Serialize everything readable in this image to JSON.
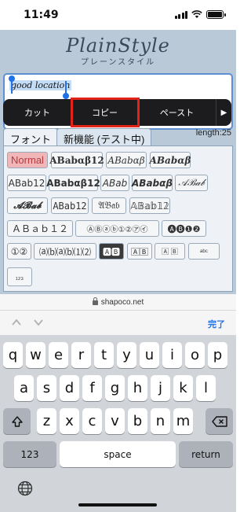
{
  "status_bar": {
    "time": "11:49"
  },
  "page": {
    "logo_main": "PlainStyle",
    "logo_sub": "プレーンスタイル",
    "input_value": "good location",
    "context_menu": {
      "cut": "カット",
      "copy": "コピー",
      "paste": "ペースト",
      "more_icon": "triangle-right-icon"
    },
    "tabs": [
      "フォント",
      "新機能 (テスト中)"
    ],
    "length_label": "length:25",
    "font_buttons": [
      [
        "Normal",
        "𝐀𝐁𝐚𝐛𝛂𝛃𝟏𝟐",
        "𝐴𝐵𝑎𝑏𝛼𝛽",
        "𝑨𝑩𝒂𝒃𝜶𝜷"
      ],
      [
        "𝖠𝖡𝖺𝖻𝟣𝟤",
        "𝗔𝗕𝗮𝗯𝝰𝝱𝟭𝟮",
        "𝘈𝘉𝘢𝘣",
        "𝘼𝘽𝙖𝙗𝞪𝞫",
        "𝒜ℬ𝒶𝒷"
      ],
      [
        "𝓐𝓑𝓪𝓫",
        "𝙰𝙱𝚊𝚋𝟷𝟸",
        "𝔄𝔅𝔞𝔟",
        "𝔸𝔹𝕒𝕓𝟙𝟚"
      ],
      [
        "ＡＢａｂ１２",
        "ⒶⒷⓐⓑ①②㋐㋑",
        "🅐🅑❶❷"
      ],
      [
        "①②",
        "⒜⒝⒜⒝⑴⑵",
        "🅰🅱",
        "🄰🄱",
        "🄰 🄱",
        "ᵃᵇᶜ"
      ],
      [
        "₁₂₃"
      ]
    ]
  },
  "url_bar": {
    "domain": "shapoco.net"
  },
  "accessory": {
    "done": "完了"
  },
  "keyboard": {
    "row1": [
      "q",
      "w",
      "e",
      "r",
      "t",
      "y",
      "u",
      "i",
      "o",
      "p"
    ],
    "row2": [
      "a",
      "s",
      "d",
      "f",
      "g",
      "h",
      "j",
      "k",
      "l"
    ],
    "row3": [
      "z",
      "x",
      "c",
      "v",
      "b",
      "n",
      "m"
    ],
    "numbers": "123",
    "space": "space",
    "return": "return"
  },
  "colors": {
    "accent": "#1f72e8",
    "highlight_border": "#e2231a",
    "page_bg": "#b9c9d8"
  }
}
